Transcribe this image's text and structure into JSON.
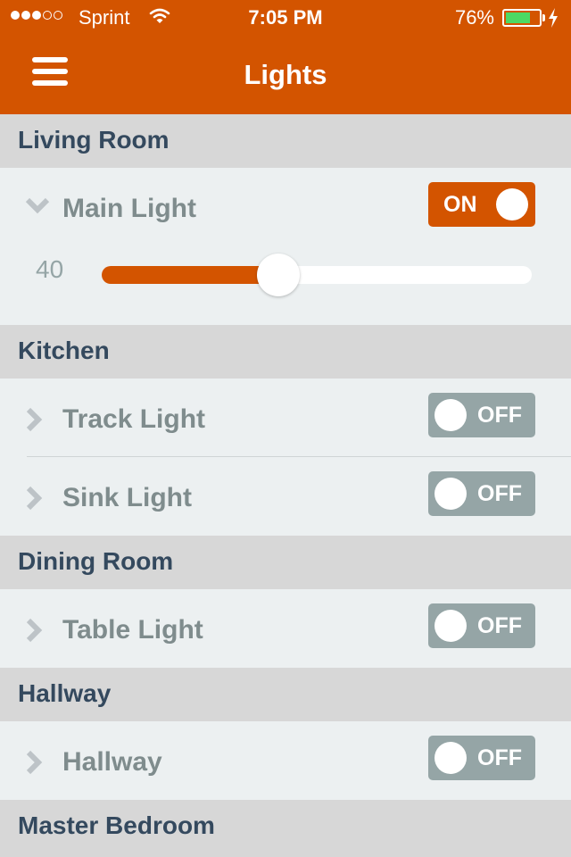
{
  "status_bar": {
    "signal_dots_filled": 3,
    "signal_dots_total": 5,
    "carrier": "Sprint",
    "time": "7:05 PM",
    "battery_text": "76%",
    "battery_level": 0.76,
    "charging": true,
    "wifi_icon": "wifi-icon",
    "bolt_icon": "lightning-icon"
  },
  "nav": {
    "title": "Lights",
    "menu_icon": "hamburger-menu-icon"
  },
  "colors": {
    "accent": "#d35400",
    "off_toggle": "#95a5a6",
    "section_bg": "#d7d7d7",
    "section_text": "#34495e",
    "row_bg": "#ecf0f1",
    "battery_green": "#4cd964"
  },
  "sections": [
    {
      "name": "Living Room",
      "lights": [
        {
          "name": "Main Light",
          "expanded": true,
          "toggle": "ON",
          "brightness": 40
        }
      ]
    },
    {
      "name": "Kitchen",
      "lights": [
        {
          "name": "Track Light",
          "expanded": false,
          "toggle": "OFF"
        },
        {
          "name": "Sink Light",
          "expanded": false,
          "toggle": "OFF"
        }
      ]
    },
    {
      "name": "Dining Room",
      "lights": [
        {
          "name": "Table Light",
          "expanded": false,
          "toggle": "OFF"
        }
      ]
    },
    {
      "name": "Hallway",
      "lights": [
        {
          "name": "Hallway",
          "expanded": false,
          "toggle": "OFF"
        }
      ]
    },
    {
      "name": "Master Bedroom",
      "lights": []
    }
  ]
}
